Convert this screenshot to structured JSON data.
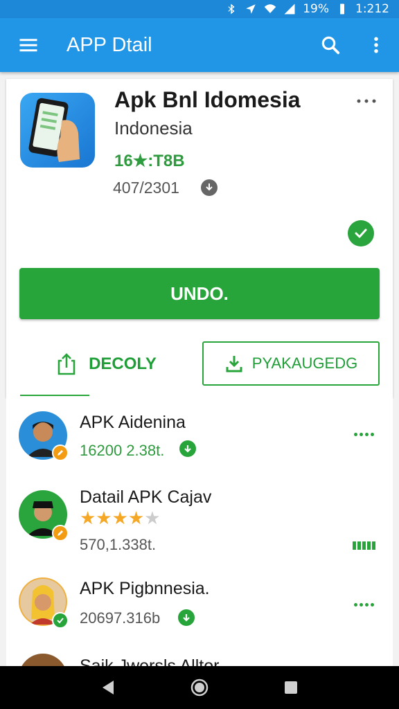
{
  "status_bar": {
    "battery": "19%",
    "time": "1:212"
  },
  "app_bar": {
    "title": "APP Dtail"
  },
  "app": {
    "name": "Apk Bnl Idomesia",
    "subtitle": "Indonesia",
    "rating": "16★:T8B",
    "count": "407/2301"
  },
  "actions": {
    "primary_label": "UNDO.",
    "share_label": "DECOLY",
    "package_label": "PYAKAUGEDG"
  },
  "list": [
    {
      "title": "APK Aidenina",
      "sub": "16200 2.38t.",
      "sub_color": "#2e9b3e"
    },
    {
      "title": "Datail APK Cajav",
      "sub": "570,1.338t.",
      "sub_color": "#555555",
      "stars": 4.5
    },
    {
      "title": "APK Pigbnnesia.",
      "sub": "20697.316b",
      "sub_color": "#555555"
    },
    {
      "title": "Saik Jwersls Alltor"
    }
  ],
  "colors": {
    "primary": "#2196e6",
    "accent": "#27a43a"
  }
}
